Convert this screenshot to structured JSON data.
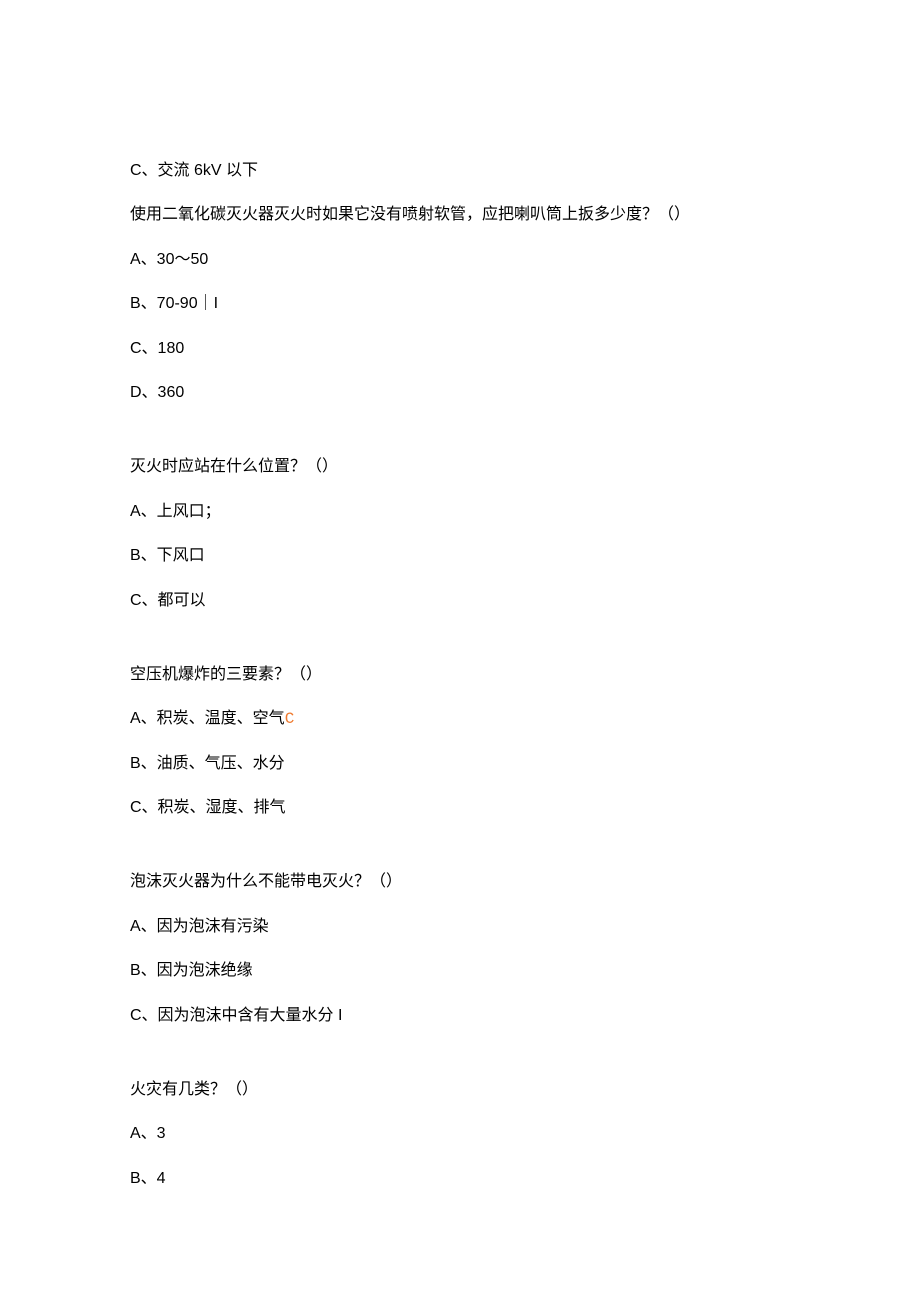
{
  "lines": {
    "l01": "C、交流 6kV 以下",
    "l02": "使用二氧化碳灭火器灭火时如果它没有喷射软管，应把喇叭筒上扳多少度？（）",
    "l03": "A、30～50",
    "l04": "B、70-90｜I",
    "l05": "C、180",
    "l06": "D、360",
    "l07": "灭火时应站在什么位置？（）",
    "l08": "A、上风口；",
    "l09": "B、下风口",
    "l10": "C、都可以",
    "l11": "空压机爆炸的三要素？（）",
    "l12a": "A、积炭、温度、空气",
    "l12b": "C",
    "l13": "B、油质、气压、水分",
    "l14": "C、积炭、湿度、排气",
    "l15": "泡沫灭火器为什么不能带电灭火？（）",
    "l16": "A、因为泡沫有污染",
    "l17": "B、因为泡沫绝缘",
    "l18": "C、因为泡沫中含有大量水分 I",
    "l19": "火灾有几类？（）",
    "l20": "A、3",
    "l21": "B、4"
  }
}
